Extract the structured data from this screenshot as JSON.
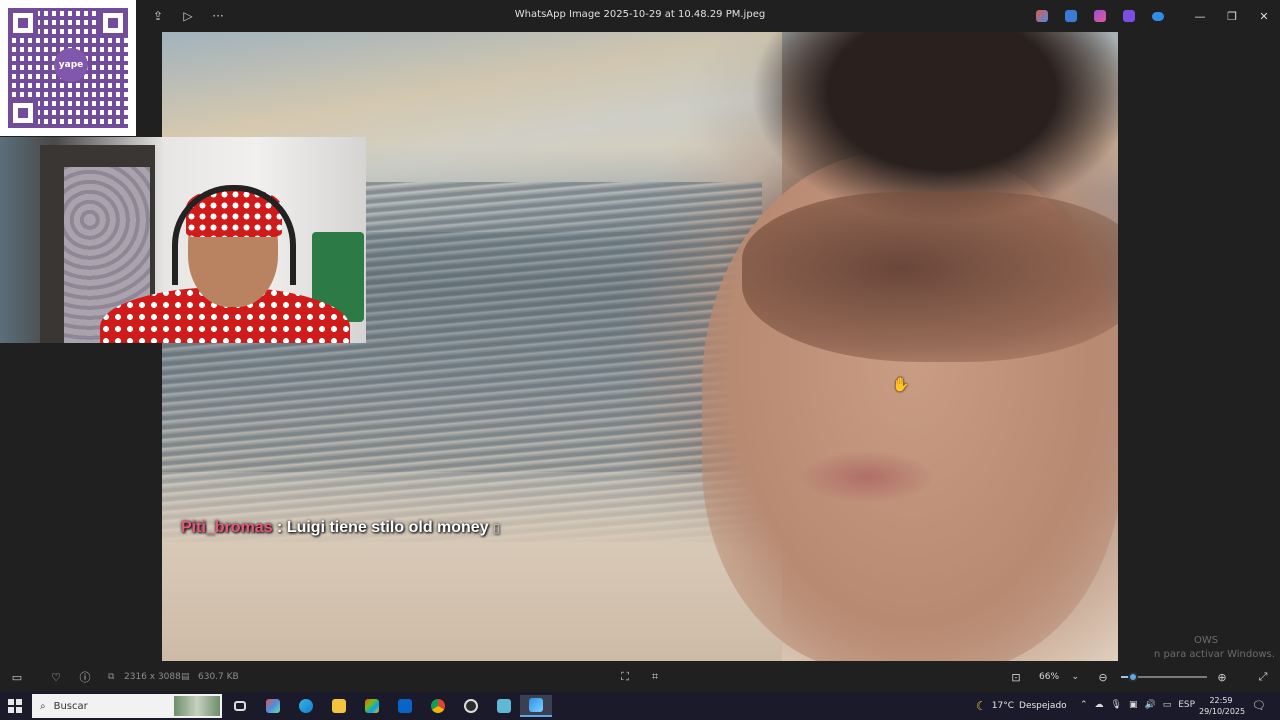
{
  "window": {
    "title": "WhatsApp Image 2025-10-29 at 10.48.29 PM.jpeg",
    "minimize_glyph": "—",
    "maximize_glyph": "❐",
    "close_glyph": "✕"
  },
  "titlebar_tools": [
    {
      "name": "share-icon",
      "glyph": "⇪"
    },
    {
      "name": "slideshow-icon",
      "glyph": "▷"
    },
    {
      "name": "more-icon",
      "glyph": "···"
    }
  ],
  "overlay": {
    "qr_logo": "yape",
    "chat_user": "Piti_bromas",
    "chat_sep": " : ",
    "chat_message": "Luigi tiene stilo old money",
    "chat_emoji": "▯"
  },
  "watermark": {
    "line1": "OWS",
    "line2": "n para activar Windows."
  },
  "toolbar": {
    "dimensions": "2316 x 3088",
    "file_size": "630.7 KB",
    "zoom_value": "66%",
    "zoom_level_percent": 66,
    "zoom_slider_fraction": 0.14
  },
  "taskbar": {
    "search_placeholder": "Buscar",
    "weather_temp": "17°C",
    "weather_desc": "Despejado",
    "language": "ESP",
    "time": "22:59",
    "date": "29/10/2025"
  },
  "colors": {
    "accent": "#5fa8e6",
    "chat_user": "#e8577c"
  }
}
